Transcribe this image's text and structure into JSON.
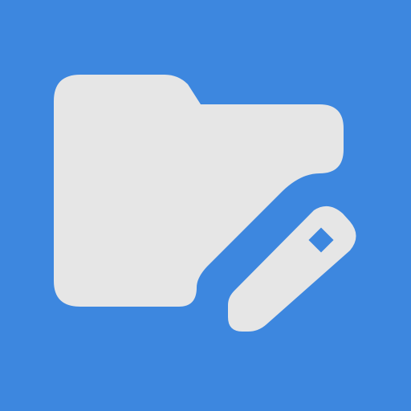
{
  "app_icon": {
    "name": "folder-edit-icon",
    "colors": {
      "background": "#3D87DF",
      "glyph": "#E6E6E6"
    },
    "parts": {
      "folder": "folder-icon",
      "pencil": "pencil-icon"
    }
  }
}
